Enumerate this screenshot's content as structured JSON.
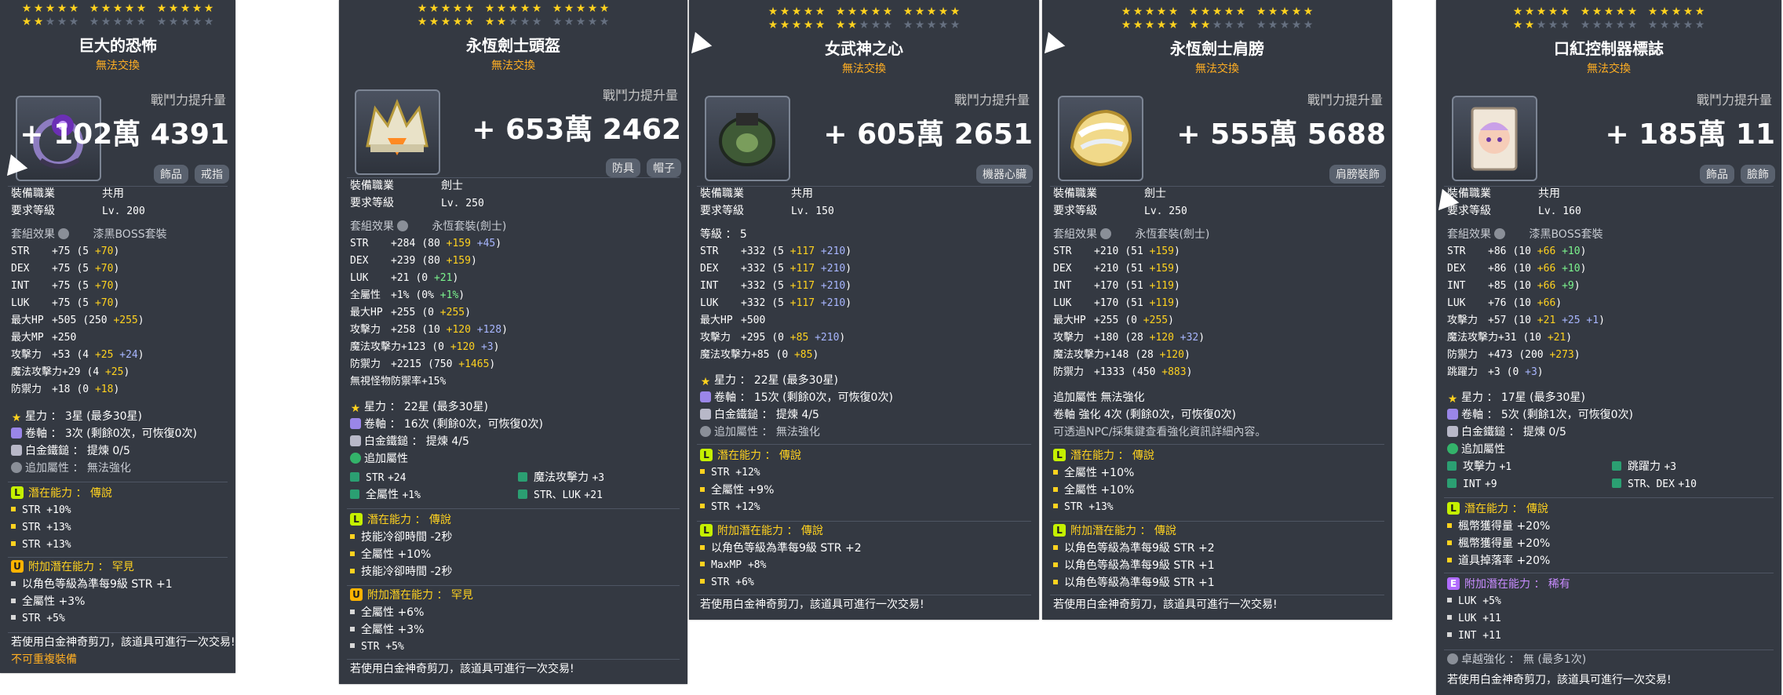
{
  "cards": [
    {
      "id": "c1",
      "star_rows": [
        15,
        2
      ],
      "title": "巨大的恐怖",
      "untradeable": "無法交換",
      "power_label": "戰鬥力提升量",
      "power": "+ 102萬 4391",
      "tags": [
        "飾品",
        "戒指"
      ],
      "job_label": "裝備職業",
      "job": "共用",
      "level_label": "要求等級",
      "level": "Lv. 200",
      "set_label": "套組效果",
      "set": "漆黑BOSS套裝",
      "stats": [
        {
          "n": "STR",
          "v": "+75",
          "base": "(5 ",
          "add": "+70",
          "enh": "",
          "close": ")"
        },
        {
          "n": "DEX",
          "v": "+75",
          "base": "(5 ",
          "add": "+70",
          "enh": "",
          "close": ")"
        },
        {
          "n": "INT",
          "v": "+75",
          "base": "(5 ",
          "add": "+70",
          "enh": "",
          "close": ")"
        },
        {
          "n": "LUK",
          "v": "+75",
          "base": "(5 ",
          "add": "+70",
          "enh": "",
          "close": ")"
        },
        {
          "n": "最大HP",
          "v": "+505",
          "base": "(250 ",
          "add": "+255",
          "enh": "",
          "close": ")"
        },
        {
          "n": "最大MP",
          "v": "+250",
          "base": "",
          "add": "",
          "enh": "",
          "close": ""
        },
        {
          "n": "攻擊力",
          "v": "+53",
          "base": "(4 ",
          "add": "+25",
          "enh": " +24",
          "close": ")"
        },
        {
          "n": "魔法攻擊力",
          "v": "+29",
          "base": "(4 ",
          "add": "+25",
          "enh": "",
          "close": ")"
        },
        {
          "n": "防禦力",
          "v": "+18",
          "base": "(0 ",
          "add": "+18",
          "enh": "",
          "close": ")"
        }
      ],
      "starforce": "星力 ： 3星 (最多30星)",
      "scroll": "卷軸 ： 3次 (剩餘0次，可恢復0次)",
      "hammer": "白金鐵鎚 ： 提煉 0/5",
      "addstat": "追加屬性 ： 無法強化",
      "potential_title": "潛在能力 ： 傳說",
      "potential": [
        "STR +10%",
        "STR +13%",
        "STR +13%"
      ],
      "bonus_title": "附加潛在能力 ： 罕見",
      "bonus": [
        "以角色等級為準每9級 STR +1",
        "全屬性 +3%",
        "STR +5%"
      ],
      "footer": "若使用白金神奇剪刀，該道具可進行一次交易!",
      "footer2": "不可重複裝備"
    },
    {
      "id": "c2",
      "star_rows": [
        15,
        7
      ],
      "title": "永恆劍士頭盔",
      "untradeable": "無法交換",
      "power_label": "戰鬥力提升量",
      "power": "+ 653萬 2462",
      "tags": [
        "防具",
        "帽子"
      ],
      "job_label": "裝備職業",
      "job": "劍士",
      "level_label": "要求等級",
      "level": "Lv. 250",
      "set_label": "套組效果",
      "set": "永恆套裝(劍士)",
      "stats": [
        {
          "n": "STR",
          "v": "+284",
          "base": "(80 ",
          "add": "+159",
          "enh": " +45",
          "close": ")"
        },
        {
          "n": "DEX",
          "v": "+239",
          "base": "(80 ",
          "add": "+159",
          "enh": "",
          "close": ")"
        },
        {
          "n": "LUK",
          "v": "+21",
          "base": "(0 ",
          "add": "",
          "enh": "+21",
          "close": ")"
        },
        {
          "n": "全屬性",
          "v": "+1%",
          "base": "(0% ",
          "add": "",
          "enh": "+1%",
          "close": ")"
        },
        {
          "n": "最大HP",
          "v": "+255",
          "base": "(0 ",
          "add": "+255",
          "enh": "",
          "close": ")"
        },
        {
          "n": "攻擊力",
          "v": "+258",
          "base": "(10 ",
          "add": "+120",
          "enh": " +128",
          "close": ")"
        },
        {
          "n": "魔法攻擊力",
          "v": "+123",
          "base": "(0 ",
          "add": "+120",
          "enh": " +3",
          "close": ")"
        },
        {
          "n": "防禦力",
          "v": "+2215",
          "base": "(750 ",
          "add": "+1465",
          "enh": "",
          "close": ")"
        },
        {
          "n": "無視怪物防禦率",
          "v": "+15%",
          "base": "",
          "add": "",
          "enh": "",
          "close": ""
        }
      ],
      "starforce": "星力 ： 22星 (最多30星)",
      "scroll": "卷軸 ： 16次 (剩餘0次，可恢復0次)",
      "hammer": "白金鐵鎚 ： 提煉 4/5",
      "add_title": "追加屬性",
      "add_grid": [
        [
          "STR",
          "+24",
          "魔法攻擊力",
          "+3"
        ],
        [
          "全屬性",
          "+1%",
          "STR、LUK",
          "+21"
        ]
      ],
      "potential_title": "潛在能力 ： 傳說",
      "potential": [
        "技能冷卻時間 -2秒",
        "全屬性 +10%",
        "技能冷卻時間 -2秒"
      ],
      "bonus_title": "附加潛在能力 ： 罕見",
      "bonus": [
        "全屬性 +6%",
        "全屬性 +3%",
        "STR +5%"
      ],
      "footer": "若使用白金神奇剪刀，該道具可進行一次交易!"
    },
    {
      "id": "c3",
      "star_rows": [
        15,
        7
      ],
      "title": "女武神之心",
      "untradeable": "無法交換",
      "power_label": "戰鬥力提升量",
      "power": "+ 605萬 2651",
      "tags": [
        "機器心臟"
      ],
      "job_label": "裝備職業",
      "job": "共用",
      "level_label": "要求等級",
      "level": "Lv. 150",
      "grade_line": "等級 ： 5",
      "stats": [
        {
          "n": "STR",
          "v": "+332",
          "base": "(5 ",
          "add": "+117",
          "enh": " +210",
          "close": ")"
        },
        {
          "n": "DEX",
          "v": "+332",
          "base": "(5 ",
          "add": "+117",
          "enh": " +210",
          "close": ")"
        },
        {
          "n": "INT",
          "v": "+332",
          "base": "(5 ",
          "add": "+117",
          "enh": " +210",
          "close": ")"
        },
        {
          "n": "LUK",
          "v": "+332",
          "base": "(5 ",
          "add": "+117",
          "enh": " +210",
          "close": ")"
        },
        {
          "n": "最大HP",
          "v": "+500",
          "base": "",
          "add": "",
          "enh": "",
          "close": ""
        },
        {
          "n": "攻擊力",
          "v": "+295",
          "base": "(0 ",
          "add": "+85",
          "enh": " +210",
          "close": ")"
        },
        {
          "n": "魔法攻擊力",
          "v": "+85",
          "base": "(0 ",
          "add": "+85",
          "enh": "",
          "close": ")"
        }
      ],
      "starforce": "星力 ： 22星 (最多30星)",
      "scroll": "卷軸 ： 15次 (剩餘0次，可恢復0次)",
      "hammer": "白金鐵鎚 ： 提煉 4/5",
      "addstat": "追加屬性 ： 無法強化",
      "potential_title": "潛在能力 ： 傳說",
      "potential": [
        "STR +12%",
        "全屬性 +9%",
        "STR +12%"
      ],
      "bonus_title": "附加潛在能力 ： 傳說",
      "bonus": [
        "以角色等級為準每9級 STR +2",
        "MaxMP +8%",
        "STR +6%"
      ],
      "footer": "若使用白金神奇剪刀，該道具可進行一次交易!"
    },
    {
      "id": "c4",
      "star_rows": [
        15,
        7
      ],
      "title": "永恆劍士肩膀",
      "untradeable": "無法交換",
      "power_label": "戰鬥力提升量",
      "power": "+ 555萬 5688",
      "tags": [
        "肩膀裝飾"
      ],
      "job_label": "裝備職業",
      "job": "劍士",
      "level_label": "要求等級",
      "level": "Lv. 250",
      "set_label": "套組效果",
      "set": "永恆套裝(劍士)",
      "stats": [
        {
          "n": "STR",
          "v": "+210",
          "base": "(51 ",
          "add": "+159",
          "enh": "",
          "close": ")"
        },
        {
          "n": "DEX",
          "v": "+210",
          "base": "(51 ",
          "add": "+159",
          "enh": "",
          "close": ")"
        },
        {
          "n": "INT",
          "v": "+170",
          "base": "(51 ",
          "add": "+119",
          "enh": "",
          "close": ")"
        },
        {
          "n": "LUK",
          "v": "+170",
          "base": "(51 ",
          "add": "+119",
          "enh": "",
          "close": ")"
        },
        {
          "n": "最大HP",
          "v": "+255",
          "base": "(0 ",
          "add": "+255",
          "enh": "",
          "close": ")"
        },
        {
          "n": "攻擊力",
          "v": "+180",
          "base": "(28 ",
          "add": "+120",
          "enh": " +32",
          "close": ")"
        },
        {
          "n": "魔法攻擊力",
          "v": "+148",
          "base": "(28 ",
          "add": "+120",
          "enh": "",
          "close": ")"
        },
        {
          "n": "防禦力",
          "v": "+1333",
          "base": "(450 ",
          "add": "+883",
          "enh": "",
          "close": ")"
        }
      ],
      "extra_lines": [
        "追加屬性 無法強化",
        "卷軸 強化 4次 (剩餘0次，可恢復0次)",
        "可透過NPC/採集鍵查看強化資訊詳細內容。"
      ],
      "potential_title": "潛在能力 ： 傳說",
      "potential": [
        "全屬性 +10%",
        "全屬性 +10%",
        "STR +13%"
      ],
      "bonus_title": "附加潛在能力 ： 傳說",
      "bonus": [
        "以角色等級為準每9級 STR +2",
        "以角色等級為準每9級 STR +1",
        "以角色等級為準每9級 STR +1"
      ],
      "footer": "若使用白金神奇剪刀，該道具可進行一次交易!"
    },
    {
      "id": "c5",
      "star_rows": [
        15,
        2
      ],
      "title": "口紅控制器標誌",
      "untradeable": "無法交換",
      "power_label": "戰鬥力提升量",
      "power": "+ 185萬 11",
      "tags": [
        "飾品",
        "臉飾"
      ],
      "job_label": "裝備職業",
      "job": "共用",
      "level_label": "要求等級",
      "level": "Lv. 160",
      "set_label": "套組效果",
      "set": "漆黑BOSS套裝",
      "stats": [
        {
          "n": "STR",
          "v": "+86",
          "base": "(10 ",
          "add": "+66",
          "enh": " +10",
          "close": ")"
        },
        {
          "n": "DEX",
          "v": "+86",
          "base": "(10 ",
          "add": "+66",
          "enh": " +10",
          "close": ")"
        },
        {
          "n": "INT",
          "v": "+85",
          "base": "(10 ",
          "add": "+66",
          "enh": " +9",
          "close": ")"
        },
        {
          "n": "LUK",
          "v": "+76",
          "base": "(10 ",
          "add": "+66",
          "enh": "",
          "close": ")"
        },
        {
          "n": "攻擊力",
          "v": "+57",
          "base": "(10 ",
          "add": "+21",
          "enh": " +25 +1",
          "close": ")"
        },
        {
          "n": "魔法攻擊力",
          "v": "+31",
          "base": "(10 ",
          "add": "+21",
          "enh": "",
          "close": ")"
        },
        {
          "n": "防禦力",
          "v": "+473",
          "base": "(200 ",
          "add": "+273",
          "enh": "",
          "close": ")"
        },
        {
          "n": "跳躍力",
          "v": "+3",
          "base": "(0 ",
          "add": "",
          "enh": "+3",
          "close": ")"
        }
      ],
      "starforce": "星力 ： 17星 (最多30星)",
      "scroll": "卷軸 ： 5次 (剩餘1次，可恢復0次)",
      "hammer": "白金鐵鎚 ： 提煉 0/5",
      "add_title": "追加屬性",
      "add_grid": [
        [
          "攻擊力",
          "+1",
          "跳躍力",
          "+3"
        ],
        [
          "INT",
          "+9",
          "STR、DEX",
          "+10"
        ]
      ],
      "potential_title": "潛在能力 ： 傳說",
      "potential": [
        "楓幣獲得量 +20%",
        "楓幣獲得量 +20%",
        "道具掉落率 +20%"
      ],
      "bonus_title": "附加潛在能力 ： 稀有",
      "bonus": [
        "LUK +5%",
        "LUK +11",
        "INT +11"
      ],
      "transcend": "卓越強化 ： 無 (最多1次)",
      "footer": "若使用白金神奇剪刀，該道具可進行一次交易!"
    }
  ]
}
